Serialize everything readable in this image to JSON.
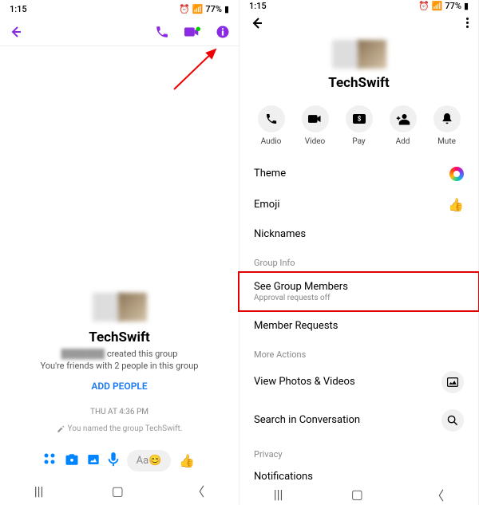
{
  "status": {
    "time": "1:15",
    "battery": "77%",
    "time2": "1:15"
  },
  "left": {
    "group_name": "TechSwift",
    "created": "created this group",
    "friends": "You're friends with 2 people in this group",
    "add_people": "ADD PEOPLE",
    "timestamp": "THU AT 4:36 PM",
    "named_msg": "You named the group TechSwift.",
    "placeholder": "Aa"
  },
  "right": {
    "group_name": "TechSwift",
    "actions": {
      "audio": "Audio",
      "video": "Video",
      "pay": "Pay",
      "add": "Add",
      "mute": "Mute"
    },
    "theme": "Theme",
    "emoji": "Emoji",
    "nicknames": "Nicknames",
    "group_info": "Group Info",
    "see_members": "See Group Members",
    "approval": "Approval requests off",
    "member_req": "Member Requests",
    "more_actions": "More Actions",
    "photos": "View Photos & Videos",
    "search": "Search in Conversation",
    "privacy": "Privacy",
    "notifications": "Notifications"
  }
}
